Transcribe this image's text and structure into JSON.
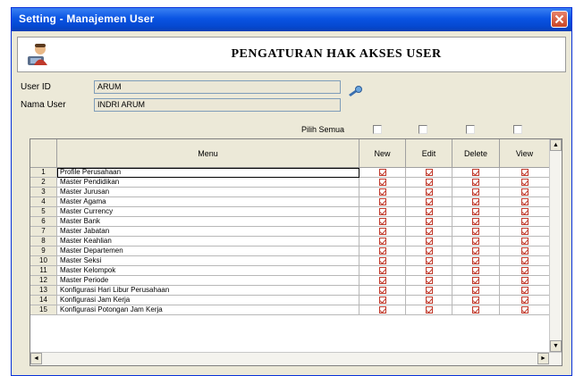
{
  "window": {
    "title": "Setting - Manajemen User"
  },
  "header": {
    "title": "PENGATURAN HAK AKSES USER"
  },
  "form": {
    "user_id_label": "User ID",
    "user_id_value": "ARUM",
    "nama_user_label": "Nama User",
    "nama_user_value": "INDRI ARUM"
  },
  "select_all": {
    "label": "Pilih Semua"
  },
  "grid": {
    "columns": [
      "Menu",
      "New",
      "Edit",
      "Delete",
      "View"
    ],
    "rows": [
      {
        "no": "1",
        "menu": "Profile Perusahaan"
      },
      {
        "no": "2",
        "menu": "Master Pendidikan"
      },
      {
        "no": "3",
        "menu": "Master Jurusan"
      },
      {
        "no": "4",
        "menu": "Master Agama"
      },
      {
        "no": "5",
        "menu": "Master Currency"
      },
      {
        "no": "6",
        "menu": "Master Bank"
      },
      {
        "no": "7",
        "menu": "Master Jabatan"
      },
      {
        "no": "8",
        "menu": "Master Keahlian"
      },
      {
        "no": "9",
        "menu": "Master Departemen"
      },
      {
        "no": "10",
        "menu": "Master Seksi"
      },
      {
        "no": "11",
        "menu": "Master Kelompok"
      },
      {
        "no": "12",
        "menu": "Master Periode"
      },
      {
        "no": "13",
        "menu": "Konfigurasi Hari Libur Perusahaan"
      },
      {
        "no": "14",
        "menu": "Konfigurasi Jam Kerja"
      },
      {
        "no": "15",
        "menu": "Konfigurasi Potongan Jam Kerja"
      }
    ]
  },
  "icons": {
    "close": "close-icon",
    "user": "user-icon",
    "lookup": "lookup-icon"
  },
  "colors": {
    "titlebar": "#0a54e3",
    "checkmark": "#c0392b",
    "window_bg": "#ece9d8"
  }
}
